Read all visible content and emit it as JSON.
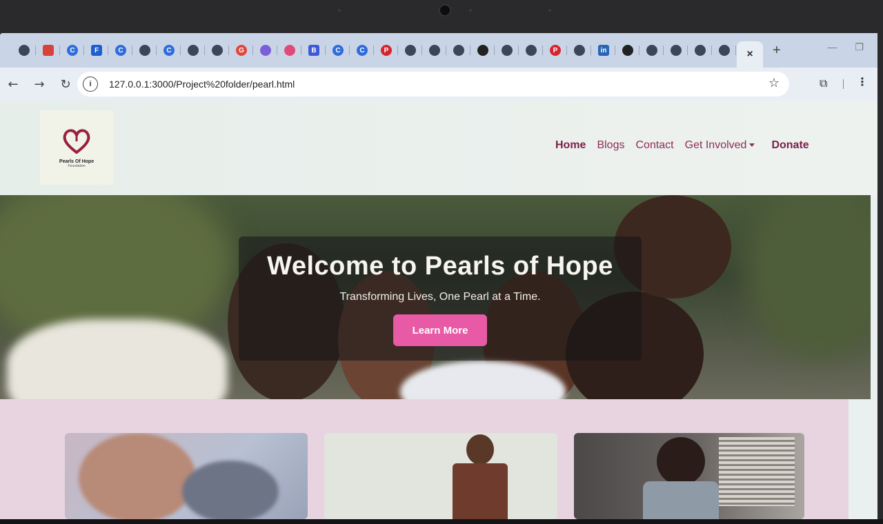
{
  "browser": {
    "tabs": [
      {
        "icon": "globe-icon",
        "glyph": "",
        "color": "#3c4658"
      },
      {
        "icon": "bars-icon",
        "glyph": "",
        "color": "#d8423a"
      },
      {
        "icon": "c-icon",
        "glyph": "C",
        "color": "#2f6ddc"
      },
      {
        "icon": "f-icon",
        "glyph": "F",
        "color": "#1d5fd1"
      },
      {
        "icon": "c-icon",
        "glyph": "C",
        "color": "#2f6ddc"
      },
      {
        "icon": "globe-icon",
        "glyph": "",
        "color": "#3c4658"
      },
      {
        "icon": "c-icon",
        "glyph": "C",
        "color": "#2f6ddc"
      },
      {
        "icon": "globe-icon",
        "glyph": "",
        "color": "#3c4658"
      },
      {
        "icon": "globe-icon",
        "glyph": "",
        "color": "#3c4658"
      },
      {
        "icon": "google-icon",
        "glyph": "G",
        "color": "#e2463a"
      },
      {
        "icon": "dots-icon",
        "glyph": "",
        "color": "#7b5fd8"
      },
      {
        "icon": "gear-icon",
        "glyph": "",
        "color": "#e04a7a"
      },
      {
        "icon": "b-icon",
        "glyph": "B",
        "color": "#3e5bd6"
      },
      {
        "icon": "c-icon",
        "glyph": "C",
        "color": "#2f6ddc"
      },
      {
        "icon": "c-icon",
        "glyph": "C",
        "color": "#2f6ddc"
      },
      {
        "icon": "pinterest-icon",
        "glyph": "P",
        "color": "#d8242f"
      },
      {
        "icon": "globe-icon",
        "glyph": "",
        "color": "#3c4658"
      },
      {
        "icon": "globe-icon",
        "glyph": "",
        "color": "#3c4658"
      },
      {
        "icon": "globe-icon",
        "glyph": "",
        "color": "#3c4658"
      },
      {
        "icon": "github-icon",
        "glyph": "",
        "color": "#222222"
      },
      {
        "icon": "globe-icon",
        "glyph": "",
        "color": "#3c4658"
      },
      {
        "icon": "globe-icon",
        "glyph": "",
        "color": "#3c4658"
      },
      {
        "icon": "pinterest-icon",
        "glyph": "P",
        "color": "#d8242f"
      },
      {
        "icon": "globe-icon",
        "glyph": "",
        "color": "#3c4658"
      },
      {
        "icon": "linkedin-icon",
        "glyph": "in",
        "color": "#2a64b8"
      },
      {
        "icon": "github-icon",
        "glyph": "",
        "color": "#222222"
      },
      {
        "icon": "globe-icon",
        "glyph": "",
        "color": "#3c4658"
      },
      {
        "icon": "globe-icon",
        "glyph": "",
        "color": "#3c4658"
      },
      {
        "icon": "globe-icon",
        "glyph": "",
        "color": "#3c4658"
      },
      {
        "icon": "globe-icon",
        "glyph": "",
        "color": "#3c4658"
      }
    ],
    "active_tab_close": "×",
    "new_tab": "+",
    "url": "127.0.0.1:3000/Project%20folder/pearl.html"
  },
  "site": {
    "logo": {
      "name": "Pearls Of Hope",
      "sub": "Foundation",
      "heart_color": "#9a1e3e"
    },
    "nav": {
      "home": "Home",
      "blogs": "Blogs",
      "contact": "Contact",
      "get_involved": "Get Involved",
      "donate": "Donate"
    },
    "hero": {
      "title": "Welcome to Pearls of Hope",
      "subtitle": "Transforming Lives, One Pearl at a Time.",
      "button": "Learn More",
      "button_color": "#e85aa6"
    },
    "colors": {
      "nav_text": "#8e2c5b",
      "cards_background": "#e7d4e0"
    }
  }
}
